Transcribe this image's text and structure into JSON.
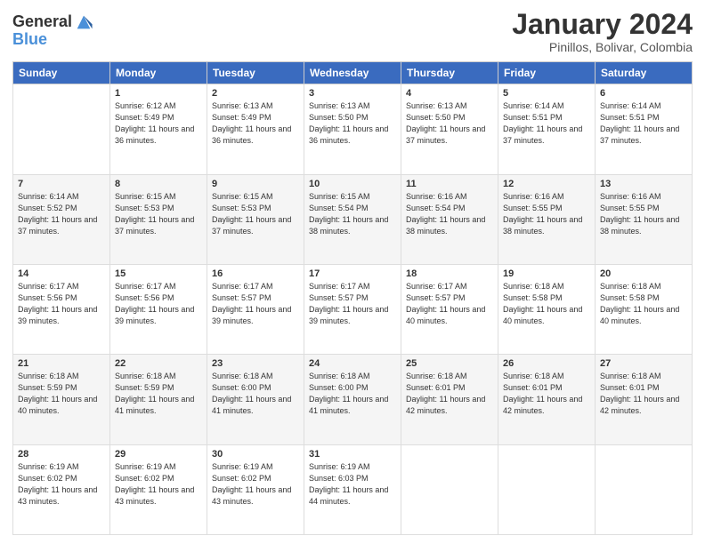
{
  "header": {
    "logo_line1": "General",
    "logo_line2": "Blue",
    "month": "January 2024",
    "location": "Pinillos, Bolivar, Colombia"
  },
  "weekdays": [
    "Sunday",
    "Monday",
    "Tuesday",
    "Wednesday",
    "Thursday",
    "Friday",
    "Saturday"
  ],
  "weeks": [
    [
      {
        "day": "",
        "sunrise": "",
        "sunset": "",
        "daylight": ""
      },
      {
        "day": "1",
        "sunrise": "Sunrise: 6:12 AM",
        "sunset": "Sunset: 5:49 PM",
        "daylight": "Daylight: 11 hours and 36 minutes."
      },
      {
        "day": "2",
        "sunrise": "Sunrise: 6:13 AM",
        "sunset": "Sunset: 5:49 PM",
        "daylight": "Daylight: 11 hours and 36 minutes."
      },
      {
        "day": "3",
        "sunrise": "Sunrise: 6:13 AM",
        "sunset": "Sunset: 5:50 PM",
        "daylight": "Daylight: 11 hours and 36 minutes."
      },
      {
        "day": "4",
        "sunrise": "Sunrise: 6:13 AM",
        "sunset": "Sunset: 5:50 PM",
        "daylight": "Daylight: 11 hours and 37 minutes."
      },
      {
        "day": "5",
        "sunrise": "Sunrise: 6:14 AM",
        "sunset": "Sunset: 5:51 PM",
        "daylight": "Daylight: 11 hours and 37 minutes."
      },
      {
        "day": "6",
        "sunrise": "Sunrise: 6:14 AM",
        "sunset": "Sunset: 5:51 PM",
        "daylight": "Daylight: 11 hours and 37 minutes."
      }
    ],
    [
      {
        "day": "7",
        "sunrise": "Sunrise: 6:14 AM",
        "sunset": "Sunset: 5:52 PM",
        "daylight": "Daylight: 11 hours and 37 minutes."
      },
      {
        "day": "8",
        "sunrise": "Sunrise: 6:15 AM",
        "sunset": "Sunset: 5:53 PM",
        "daylight": "Daylight: 11 hours and 37 minutes."
      },
      {
        "day": "9",
        "sunrise": "Sunrise: 6:15 AM",
        "sunset": "Sunset: 5:53 PM",
        "daylight": "Daylight: 11 hours and 37 minutes."
      },
      {
        "day": "10",
        "sunrise": "Sunrise: 6:15 AM",
        "sunset": "Sunset: 5:54 PM",
        "daylight": "Daylight: 11 hours and 38 minutes."
      },
      {
        "day": "11",
        "sunrise": "Sunrise: 6:16 AM",
        "sunset": "Sunset: 5:54 PM",
        "daylight": "Daylight: 11 hours and 38 minutes."
      },
      {
        "day": "12",
        "sunrise": "Sunrise: 6:16 AM",
        "sunset": "Sunset: 5:55 PM",
        "daylight": "Daylight: 11 hours and 38 minutes."
      },
      {
        "day": "13",
        "sunrise": "Sunrise: 6:16 AM",
        "sunset": "Sunset: 5:55 PM",
        "daylight": "Daylight: 11 hours and 38 minutes."
      }
    ],
    [
      {
        "day": "14",
        "sunrise": "Sunrise: 6:17 AM",
        "sunset": "Sunset: 5:56 PM",
        "daylight": "Daylight: 11 hours and 39 minutes."
      },
      {
        "day": "15",
        "sunrise": "Sunrise: 6:17 AM",
        "sunset": "Sunset: 5:56 PM",
        "daylight": "Daylight: 11 hours and 39 minutes."
      },
      {
        "day": "16",
        "sunrise": "Sunrise: 6:17 AM",
        "sunset": "Sunset: 5:57 PM",
        "daylight": "Daylight: 11 hours and 39 minutes."
      },
      {
        "day": "17",
        "sunrise": "Sunrise: 6:17 AM",
        "sunset": "Sunset: 5:57 PM",
        "daylight": "Daylight: 11 hours and 39 minutes."
      },
      {
        "day": "18",
        "sunrise": "Sunrise: 6:17 AM",
        "sunset": "Sunset: 5:57 PM",
        "daylight": "Daylight: 11 hours and 40 minutes."
      },
      {
        "day": "19",
        "sunrise": "Sunrise: 6:18 AM",
        "sunset": "Sunset: 5:58 PM",
        "daylight": "Daylight: 11 hours and 40 minutes."
      },
      {
        "day": "20",
        "sunrise": "Sunrise: 6:18 AM",
        "sunset": "Sunset: 5:58 PM",
        "daylight": "Daylight: 11 hours and 40 minutes."
      }
    ],
    [
      {
        "day": "21",
        "sunrise": "Sunrise: 6:18 AM",
        "sunset": "Sunset: 5:59 PM",
        "daylight": "Daylight: 11 hours and 40 minutes."
      },
      {
        "day": "22",
        "sunrise": "Sunrise: 6:18 AM",
        "sunset": "Sunset: 5:59 PM",
        "daylight": "Daylight: 11 hours and 41 minutes."
      },
      {
        "day": "23",
        "sunrise": "Sunrise: 6:18 AM",
        "sunset": "Sunset: 6:00 PM",
        "daylight": "Daylight: 11 hours and 41 minutes."
      },
      {
        "day": "24",
        "sunrise": "Sunrise: 6:18 AM",
        "sunset": "Sunset: 6:00 PM",
        "daylight": "Daylight: 11 hours and 41 minutes."
      },
      {
        "day": "25",
        "sunrise": "Sunrise: 6:18 AM",
        "sunset": "Sunset: 6:01 PM",
        "daylight": "Daylight: 11 hours and 42 minutes."
      },
      {
        "day": "26",
        "sunrise": "Sunrise: 6:18 AM",
        "sunset": "Sunset: 6:01 PM",
        "daylight": "Daylight: 11 hours and 42 minutes."
      },
      {
        "day": "27",
        "sunrise": "Sunrise: 6:18 AM",
        "sunset": "Sunset: 6:01 PM",
        "daylight": "Daylight: 11 hours and 42 minutes."
      }
    ],
    [
      {
        "day": "28",
        "sunrise": "Sunrise: 6:19 AM",
        "sunset": "Sunset: 6:02 PM",
        "daylight": "Daylight: 11 hours and 43 minutes."
      },
      {
        "day": "29",
        "sunrise": "Sunrise: 6:19 AM",
        "sunset": "Sunset: 6:02 PM",
        "daylight": "Daylight: 11 hours and 43 minutes."
      },
      {
        "day": "30",
        "sunrise": "Sunrise: 6:19 AM",
        "sunset": "Sunset: 6:02 PM",
        "daylight": "Daylight: 11 hours and 43 minutes."
      },
      {
        "day": "31",
        "sunrise": "Sunrise: 6:19 AM",
        "sunset": "Sunset: 6:03 PM",
        "daylight": "Daylight: 11 hours and 44 minutes."
      },
      {
        "day": "",
        "sunrise": "",
        "sunset": "",
        "daylight": ""
      },
      {
        "day": "",
        "sunrise": "",
        "sunset": "",
        "daylight": ""
      },
      {
        "day": "",
        "sunrise": "",
        "sunset": "",
        "daylight": ""
      }
    ]
  ]
}
